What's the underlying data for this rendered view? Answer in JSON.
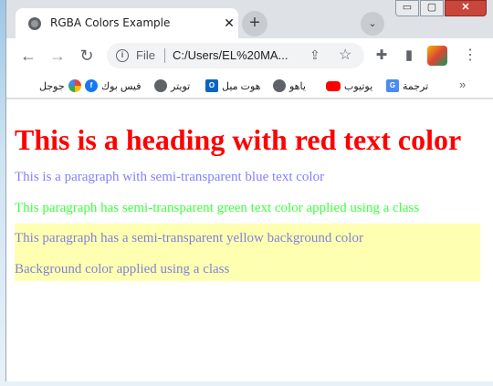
{
  "window": {
    "tab_title": "RGBA Colors Example",
    "new_tab_label": "+",
    "close_tab_label": "✕",
    "tab_search_label": "⌄",
    "controls": {
      "minimize": "▭",
      "maximize": "▢",
      "close": "✕"
    }
  },
  "toolbar": {
    "back": "←",
    "forward": "→",
    "reload": "↻",
    "info_glyph": "i",
    "file_label": "File",
    "url": "C:/Users/EL%20MA...",
    "share": "⇪",
    "star": "☆",
    "extensions": "✚",
    "sidepanel": "▮",
    "menu": "⋮"
  },
  "bookmarks": {
    "items": [
      {
        "label": "جوجل",
        "icon": "google-icon"
      },
      {
        "label": "فيس بوك",
        "icon": "facebook-icon"
      },
      {
        "label": "تويتر",
        "icon": "globe-icon"
      },
      {
        "label": "هوت ميل",
        "icon": "outlook-icon"
      },
      {
        "label": "ياهو",
        "icon": "globe-icon"
      },
      {
        "label": "يوتيوب",
        "icon": "youtube-icon"
      },
      {
        "label": "ترجمة",
        "icon": "translate-icon"
      }
    ],
    "more": "»"
  },
  "page": {
    "heading": "This is a heading with red text color",
    "para_blue": "This is a paragraph with semi-transparent blue text color",
    "para_green": "This paragraph has semi-transparent green text color applied using a class",
    "para_yellow": "This paragraph has a semi-transparent yellow background color",
    "para_class": "Background color applied using a class"
  },
  "colors": {
    "heading": "#ff0000",
    "blue_text": "rgba(0,0,255,0.5)",
    "green_text": "rgba(0,255,0,0.75)",
    "yellow_bg": "rgba(255,255,0,0.3)"
  }
}
